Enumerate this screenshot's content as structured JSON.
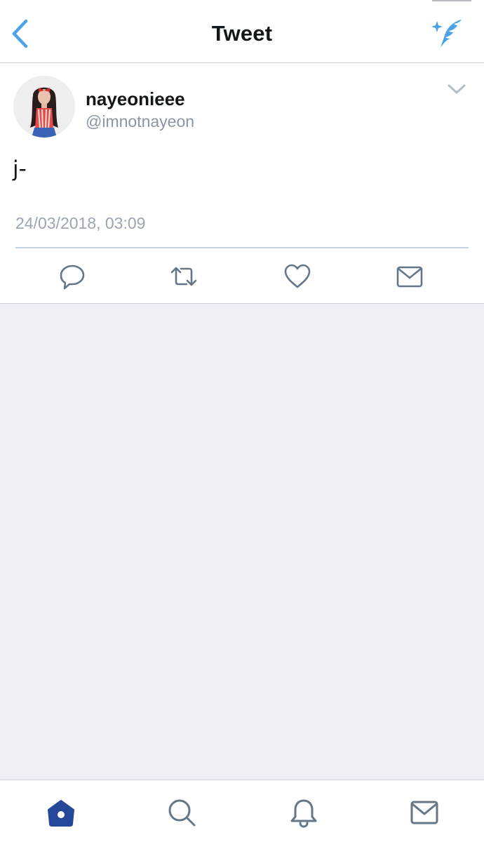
{
  "nav": {
    "title": "Tweet",
    "back_icon": "chevron-left-icon",
    "compose_icon": "sparkle-feather-icon"
  },
  "tweet": {
    "display_name": "nayeonieee",
    "handle": "@imnotnayeon",
    "text": "j-",
    "timestamp": "24/03/2018, 03:09",
    "actions": [
      "reply-icon",
      "retweet-icon",
      "like-icon",
      "dm-icon"
    ]
  },
  "tabs": [
    {
      "name": "home",
      "icon": "home-icon",
      "active": true
    },
    {
      "name": "search",
      "icon": "search-icon",
      "active": false
    },
    {
      "name": "notifications",
      "icon": "bell-icon",
      "active": false
    },
    {
      "name": "messages",
      "icon": "envelope-icon",
      "active": false
    }
  ],
  "colors": {
    "accent": "#4aa3e8",
    "active_tab": "#24479a",
    "icon_gray": "#657786",
    "text": "#14171a",
    "muted": "#8a96a3",
    "background_gray": "#efeff4"
  }
}
